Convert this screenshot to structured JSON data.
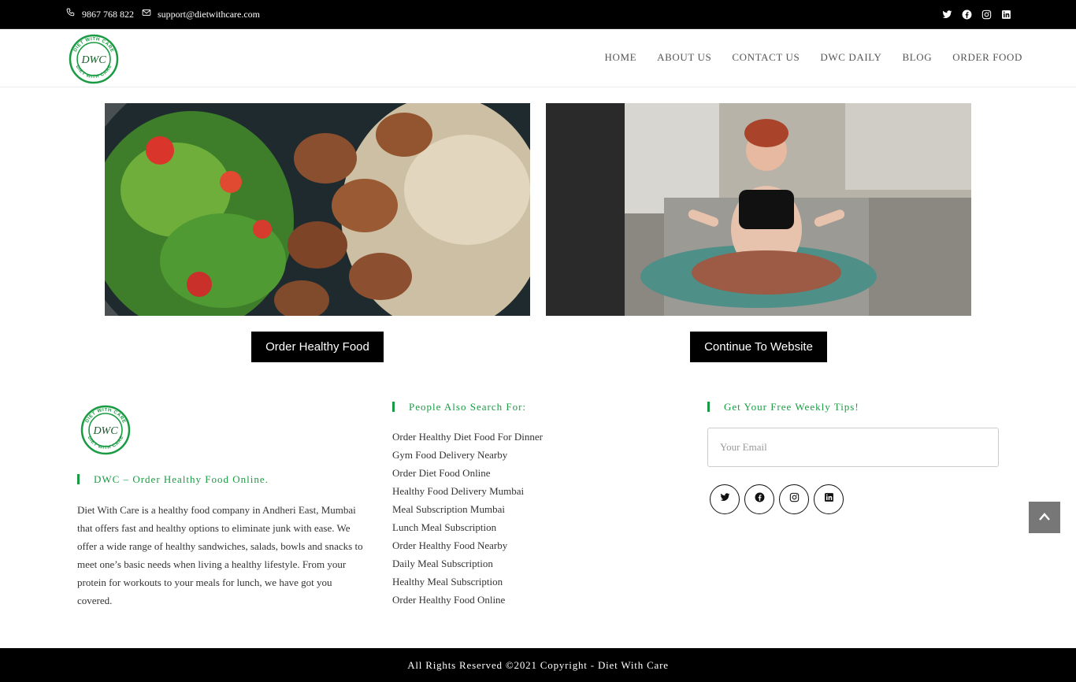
{
  "colors": {
    "brand_green": "#1a9b43",
    "dark": "#000000",
    "scroll_top_bg": "#777777"
  },
  "topbar": {
    "phone": "9867 768 822",
    "email": "support@dietwithcare.com",
    "phone_icon": "phone-icon",
    "email_icon": "envelope-icon",
    "social_icons": [
      "twitter-icon",
      "facebook-icon",
      "instagram-icon",
      "linkedin-icon"
    ]
  },
  "header": {
    "logo_text": "DWC",
    "logo_ring_text": "DIET WITH CARE",
    "nav": [
      "HOME",
      "ABOUT US",
      "CONTACT US",
      "DWC DAILY",
      "BLOG",
      "ORDER FOOD"
    ]
  },
  "hero": {
    "order_button": "Order Healthy Food",
    "continue_button": "Continue To Website"
  },
  "footer": {
    "about_title": "DWC – Order Healthy Food Online.",
    "about_text": "Diet With Care is a healthy food company in Andheri East, Mumbai that offers fast and healthy options to eliminate junk with ease. We offer a wide range of healthy sandwiches, salads, bowls and snacks to meet one’s basic needs when living a healthy lifestyle. From your protein for workouts to your meals for lunch, we have got you covered.",
    "search_title": "People Also Search For:",
    "search_links": [
      "Order Healthy Diet Food For Dinner",
      "Gym Food Delivery Nearby",
      "Order Diet Food Online",
      "Healthy Food Delivery Mumbai",
      "Meal Subscription Mumbai",
      "Lunch Meal Subscription",
      "Order Healthy Food Nearby",
      "Daily Meal Subscription",
      "Healthy Meal Subscription",
      "Order Healthy Food Online"
    ],
    "tips_title": "Get Your Free Weekly Tips!",
    "email_placeholder": "Your Email",
    "social_icons": [
      "twitter-icon",
      "facebook-icon",
      "instagram-icon",
      "linkedin-icon"
    ],
    "copyright": "All Rights Reserved ©2021 Copyright - Diet With Care"
  }
}
